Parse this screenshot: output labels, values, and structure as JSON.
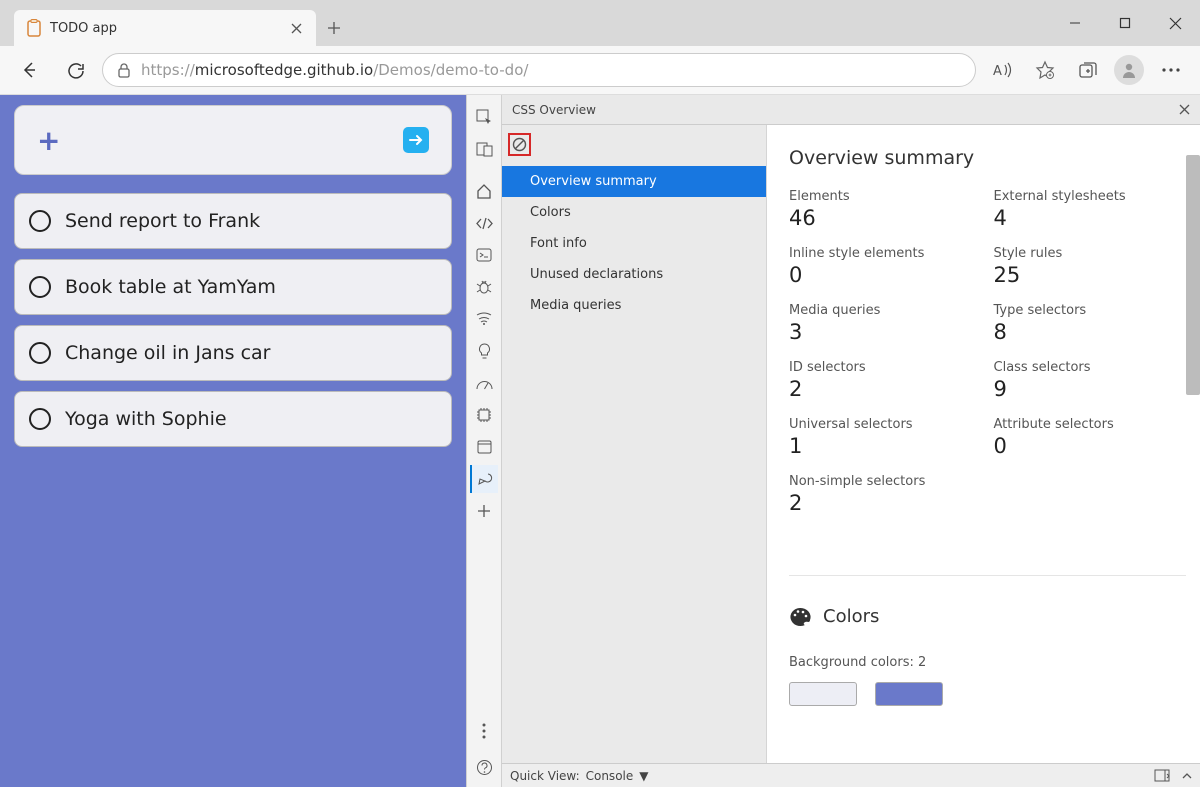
{
  "browser": {
    "tab_title": "TODO app",
    "url_proto": "https://",
    "url_host": "microsoftedge.github.io",
    "url_path": "/Demos/demo-to-do/"
  },
  "app": {
    "tasks": [
      "Send report to Frank",
      "Book table at YamYam",
      "Change oil in Jans car",
      "Yoga with Sophie"
    ]
  },
  "devtools": {
    "panel_title": "CSS Overview",
    "nav": [
      "Overview summary",
      "Colors",
      "Font info",
      "Unused declarations",
      "Media queries"
    ],
    "quickview_label": "Quick View:",
    "quickview_value": "Console"
  },
  "overview": {
    "heading": "Overview summary",
    "stats": [
      {
        "label": "Elements",
        "value": "46"
      },
      {
        "label": "External stylesheets",
        "value": "4"
      },
      {
        "label": "Inline style elements",
        "value": "0"
      },
      {
        "label": "Style rules",
        "value": "25"
      },
      {
        "label": "Media queries",
        "value": "3"
      },
      {
        "label": "Type selectors",
        "value": "8"
      },
      {
        "label": "ID selectors",
        "value": "2"
      },
      {
        "label": "Class selectors",
        "value": "9"
      },
      {
        "label": "Universal selectors",
        "value": "1"
      },
      {
        "label": "Attribute selectors",
        "value": "0"
      },
      {
        "label": "Non-simple selectors",
        "value": "2"
      }
    ],
    "colors_heading": "Colors",
    "bg_colors_label": "Background colors: 2",
    "swatches": [
      "#edeef5",
      "#6a79ca"
    ]
  }
}
